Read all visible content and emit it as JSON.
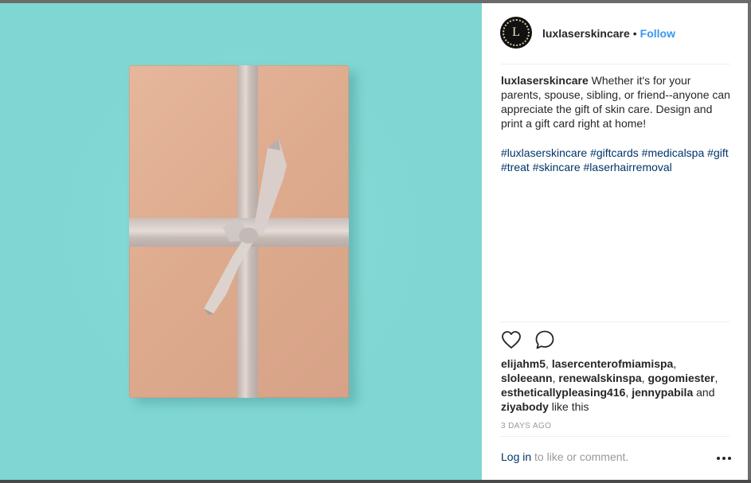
{
  "post": {
    "username": "luxlaserskincare",
    "avatar_letter": "L",
    "follow_label": "Follow",
    "separator": "•",
    "caption_text": "Whether it's for your parents, spouse, sibling, or friend--anyone can appreciate the gift of skin care. Design and print a gift card right at home!",
    "hashtags": [
      "#luxlaserskincare",
      "#giftcards",
      "#medicalspa",
      "#gift",
      "#treat",
      "#skincare",
      "#laserhairremoval"
    ],
    "likers": [
      "elijahm5",
      "lasercenterofmiamispa",
      "sloleeann",
      "renewalskinspa",
      "gogomiester",
      "estheticallypleasing416",
      "jennypabila",
      "ziyabody"
    ],
    "likes_and": "and",
    "likes_suffix": "like this",
    "timestamp": "3 DAYS AGO",
    "login_link": "Log in",
    "login_suffix": "to like or comment."
  },
  "icons": {
    "like": "heart-icon",
    "comment": "comment-icon",
    "more": "more-options-icon"
  },
  "colors": {
    "background_teal": "#7fd6d2",
    "follow_blue": "#3897f0",
    "hashtag_navy": "#003569",
    "text_dark": "#262626",
    "muted": "#999999"
  }
}
